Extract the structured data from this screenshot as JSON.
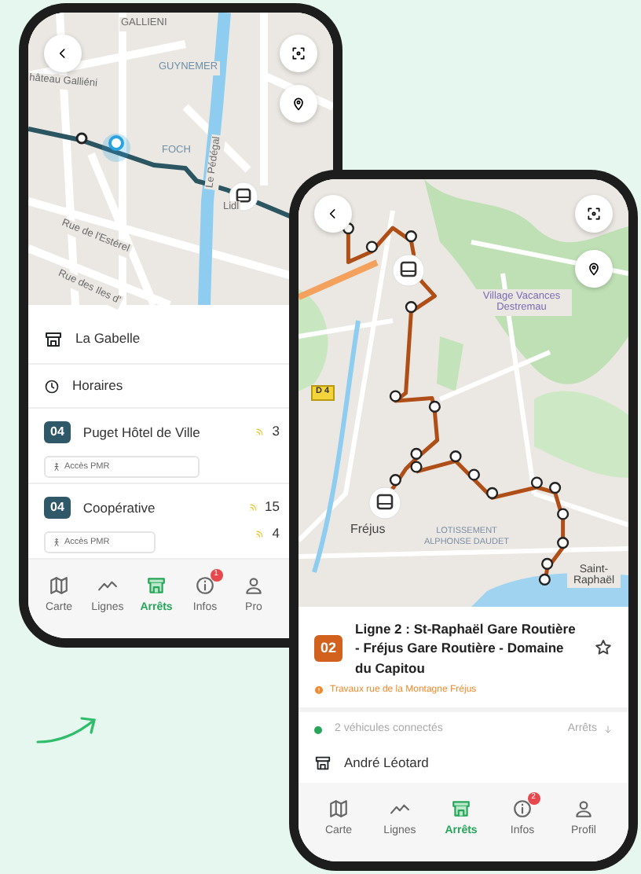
{
  "back_phone": {
    "map_labels": [
      "GALLIENI",
      "hâteau Galliéni",
      "GUYNEMER",
      "Le Pédégal",
      "FOCH",
      "Lidl",
      "Rue de l'Estérel",
      "Rue des Iles d'"
    ],
    "place": "La Gabelle",
    "schedule": "Horaires",
    "stops": [
      {
        "line": "04",
        "color": "#2f5868",
        "name": "Puget Hôtel de Ville",
        "access": "Accès PMR",
        "times": [
          "3"
        ]
      },
      {
        "line": "04",
        "color": "#2f5868",
        "name": "Coopérative",
        "access": "Accès PMR",
        "times": [
          "15",
          "4"
        ]
      }
    ],
    "nav": [
      {
        "label": "Carte",
        "selected": false
      },
      {
        "label": "Lignes",
        "selected": false
      },
      {
        "label": "Arrêts",
        "selected": true
      },
      {
        "label": "Infos",
        "selected": false,
        "badge": "1"
      },
      {
        "label": "Pro",
        "selected": false
      }
    ]
  },
  "front_phone": {
    "map_labels": [
      "D 4",
      "Village Vacances Destremau",
      "Fréjus",
      "LOTISSEMENT ALPHONSE DAUDET",
      "Saint-Raphaël"
    ],
    "route": {
      "line": "02",
      "color": "#d2611d",
      "title": "Ligne 2 : St-Raphaël Gare Routière - Fréjus Gare Routière - Domaine du Capitou",
      "starred": false,
      "alert": "Travaux rue de la Montagne Fréjus"
    },
    "vehicles": "2 véhicules connectés",
    "stops_link": "Arrêts",
    "stop": "André Léotard",
    "nav": [
      {
        "label": "Carte",
        "selected": false
      },
      {
        "label": "Lignes",
        "selected": false
      },
      {
        "label": "Arrêts",
        "selected": true
      },
      {
        "label": "Infos",
        "selected": false,
        "badge": "2"
      },
      {
        "label": "Profil",
        "selected": false
      }
    ]
  }
}
